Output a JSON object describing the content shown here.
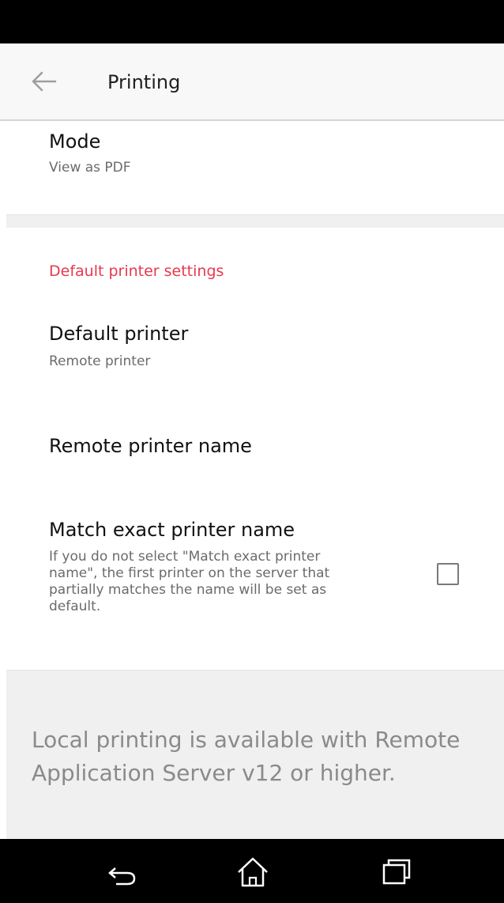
{
  "app_bar": {
    "title": "Printing",
    "back_icon": "back-arrow-icon"
  },
  "mode": {
    "title": "Mode",
    "summary": "View as PDF"
  },
  "default_printer_settings": {
    "category": "Default printer settings",
    "default_printer": {
      "title": "Default printer",
      "summary": "Remote printer"
    },
    "remote_printer_name": {
      "title": "Remote printer name"
    },
    "match_exact": {
      "title": "Match exact printer name",
      "summary_lines": [
        "If you do not select \"Match exact printer",
        "name\", the first printer on the server that",
        "partially matches the name will be set as",
        "default."
      ],
      "checked": false
    }
  },
  "footer": {
    "lines": [
      "Local printing is available with Remote",
      "Application Server v12 or higher."
    ]
  },
  "nav_bar": {
    "icons": [
      "nav-back-icon",
      "nav-home-icon",
      "nav-recents-icon"
    ]
  },
  "colors": {
    "accent": "#e8384f",
    "app_bar": "#f8f8f8",
    "footer_bg": "#f0f0f0"
  }
}
